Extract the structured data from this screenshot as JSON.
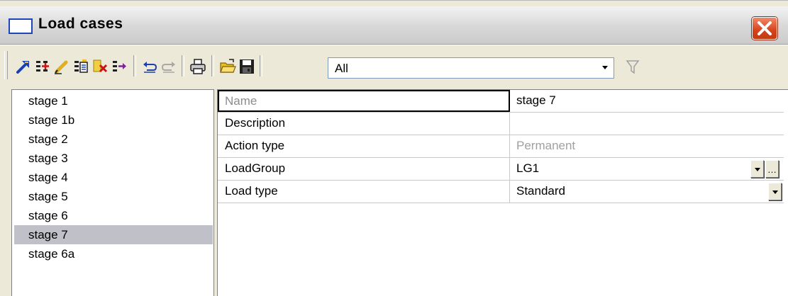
{
  "window": {
    "title": "Load cases"
  },
  "toolbar": {
    "filter_value": "All",
    "buttons": [
      "new-load-case-icon",
      "insert-icon",
      "edit-icon",
      "copy-icon",
      "delete-icon",
      "move-icon",
      "undo-icon",
      "redo-icon",
      "print-icon",
      "open-folder-icon",
      "save-icon"
    ]
  },
  "list": {
    "items": [
      "stage 1",
      "stage 1b",
      "stage 2",
      "stage 3",
      "stage 4",
      "stage 5",
      "stage 6",
      "stage 7",
      "stage 6a"
    ],
    "selected": "stage 7"
  },
  "properties": [
    {
      "name": "Name",
      "value": "stage 7"
    },
    {
      "name": "Description",
      "value": ""
    },
    {
      "name": "Action type",
      "value": "Permanent"
    },
    {
      "name": "LoadGroup",
      "value": "LG1"
    },
    {
      "name": "Load type",
      "value": "Standard"
    }
  ],
  "colors": {
    "selection": "#c0c0c8",
    "close_button": "#d5431b",
    "title_icon_border": "#1d45b9",
    "disabled_text": "#a0a0a0"
  }
}
